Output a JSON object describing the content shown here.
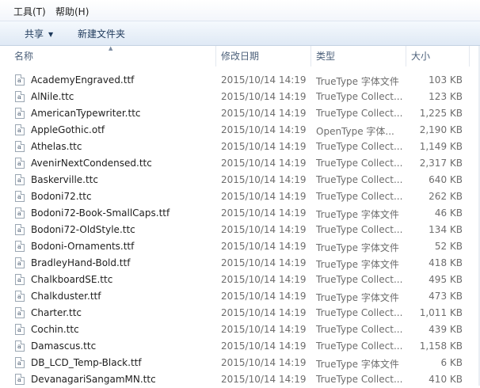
{
  "menu": [
    "工具(T)",
    "帮助(H)"
  ],
  "toolbar": {
    "share_label": "共享",
    "share_arrow": "▼",
    "new_folder_label": "新建文件夹"
  },
  "columns": {
    "name": "名称",
    "date": "修改日期",
    "type": "类型",
    "size": "大小",
    "sort_indicator": "▲"
  },
  "files": [
    {
      "name": "AcademyEngraved.ttf",
      "date": "2015/10/14 14:19",
      "type": "TrueType 字体文件",
      "size": "103 KB"
    },
    {
      "name": "AlNile.ttc",
      "date": "2015/10/14 14:19",
      "type": "TrueType Collect...",
      "size": "123 KB"
    },
    {
      "name": "AmericanTypewriter.ttc",
      "date": "2015/10/14 14:19",
      "type": "TrueType Collect...",
      "size": "1,225 KB"
    },
    {
      "name": "AppleGothic.otf",
      "date": "2015/10/14 14:19",
      "type": "OpenType 字体...",
      "size": "2,190 KB"
    },
    {
      "name": "Athelas.ttc",
      "date": "2015/10/14 14:19",
      "type": "TrueType Collect...",
      "size": "1,149 KB"
    },
    {
      "name": "AvenirNextCondensed.ttc",
      "date": "2015/10/14 14:19",
      "type": "TrueType Collect...",
      "size": "2,317 KB"
    },
    {
      "name": "Baskerville.ttc",
      "date": "2015/10/14 14:19",
      "type": "TrueType Collect...",
      "size": "640 KB"
    },
    {
      "name": "Bodoni72.ttc",
      "date": "2015/10/14 14:19",
      "type": "TrueType Collect...",
      "size": "262 KB"
    },
    {
      "name": "Bodoni72-Book-SmallCaps.ttf",
      "date": "2015/10/14 14:19",
      "type": "TrueType 字体文件",
      "size": "46 KB"
    },
    {
      "name": "Bodoni72-OldStyle.ttc",
      "date": "2015/10/14 14:19",
      "type": "TrueType Collect...",
      "size": "134 KB"
    },
    {
      "name": "Bodoni-Ornaments.ttf",
      "date": "2015/10/14 14:19",
      "type": "TrueType 字体文件",
      "size": "52 KB"
    },
    {
      "name": "BradleyHand-Bold.ttf",
      "date": "2015/10/14 14:19",
      "type": "TrueType 字体文件",
      "size": "418 KB"
    },
    {
      "name": "ChalkboardSE.ttc",
      "date": "2015/10/14 14:19",
      "type": "TrueType Collect...",
      "size": "495 KB"
    },
    {
      "name": "Chalkduster.ttf",
      "date": "2015/10/14 14:19",
      "type": "TrueType 字体文件",
      "size": "473 KB"
    },
    {
      "name": "Charter.ttc",
      "date": "2015/10/14 14:19",
      "type": "TrueType Collect...",
      "size": "1,011 KB"
    },
    {
      "name": "Cochin.ttc",
      "date": "2015/10/14 14:19",
      "type": "TrueType Collect...",
      "size": "439 KB"
    },
    {
      "name": "Damascus.ttc",
      "date": "2015/10/14 14:19",
      "type": "TrueType Collect...",
      "size": "1,158 KB"
    },
    {
      "name": "DB_LCD_Temp-Black.ttf",
      "date": "2015/10/14 14:19",
      "type": "TrueType 字体文件",
      "size": "6 KB"
    },
    {
      "name": "DevanagariSangamMN.ttc",
      "date": "2015/10/14 14:19",
      "type": "TrueType Collect...",
      "size": "410 KB"
    }
  ]
}
